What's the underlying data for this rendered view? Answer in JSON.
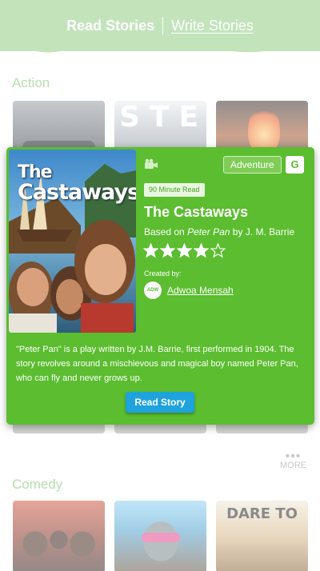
{
  "header": {
    "tabs": [
      {
        "label": "Read Stories",
        "active": true
      },
      {
        "label": "Write Stories",
        "active": false
      }
    ]
  },
  "sections": {
    "action": {
      "title": "Action"
    },
    "comedy": {
      "title": "Comedy",
      "dare_title": "DARE TO"
    }
  },
  "more": {
    "label": "MORE",
    "icon": "three-dots-icon"
  },
  "story_card": {
    "cover": {
      "title_line1": "The",
      "title_line2": "Castaways"
    },
    "genre": "Adventure",
    "rating": "G",
    "read_time": "90 Minute Read",
    "title": "The Castaways",
    "based_on_prefix": "Based on",
    "based_on_work": "Peter Pan",
    "based_on_author": "by J. M. Barrie",
    "stars_filled": 4,
    "stars_total": 5,
    "created_by_label": "Created by:",
    "avatar_text": "ADW",
    "author": "Adwoa Mensah",
    "description": "\"Peter Pan\" is a play written by J.M. Barrie, first performed in 1904. The story revolves around a mischievous and magical boy named Peter Pan, who can fly and never grows up.",
    "button_label": "Read Story"
  },
  "colors": {
    "header_bg": "#c3e4bb",
    "card_bg": "#5bbd2f",
    "button_bg": "#1ea3dd",
    "section_title": "#b7dfae"
  }
}
